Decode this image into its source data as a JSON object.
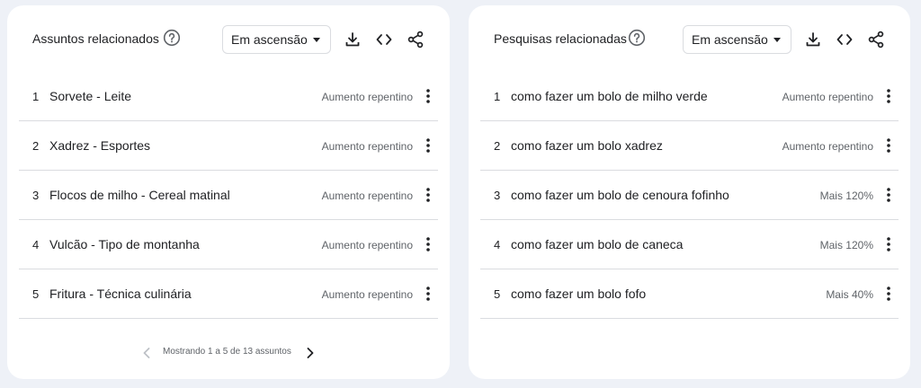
{
  "related_topics": {
    "title": "Assuntos relacionados",
    "filter": "Em ascensão",
    "rows": [
      {
        "rank": "1",
        "label": "Sorvete - Leite",
        "value": "Aumento repentino"
      },
      {
        "rank": "2",
        "label": "Xadrez - Esportes",
        "value": "Aumento repentino"
      },
      {
        "rank": "3",
        "label": "Flocos de milho - Cereal matinal",
        "value": "Aumento repentino"
      },
      {
        "rank": "4",
        "label": "Vulcão - Tipo de montanha",
        "value": "Aumento repentino"
      },
      {
        "rank": "5",
        "label": "Fritura - Técnica culinária",
        "value": "Aumento repentino"
      }
    ],
    "pagination": "Mostrando 1 a 5 de 13 assuntos"
  },
  "related_queries": {
    "title": "Pesquisas relacionadas",
    "filter": "Em ascensão",
    "rows": [
      {
        "rank": "1",
        "label": "como fazer um bolo de milho verde",
        "value": "Aumento repentino"
      },
      {
        "rank": "2",
        "label": "como fazer um bolo xadrez",
        "value": "Aumento repentino"
      },
      {
        "rank": "3",
        "label": "como fazer um bolo de cenoura fofinho",
        "value": "Mais 120%"
      },
      {
        "rank": "4",
        "label": "como fazer um bolo de caneca",
        "value": "Mais 120%"
      },
      {
        "rank": "5",
        "label": "como fazer um bolo fofo",
        "value": "Mais 40%"
      }
    ]
  },
  "icons": {
    "help": "help-circle-icon",
    "download": "download-icon",
    "embed": "code-icon",
    "share": "share-icon",
    "more": "more-vert-icon",
    "prev": "chevron-left-icon",
    "next": "chevron-right-icon"
  },
  "colors": {
    "background": "#eef1f7",
    "card": "#ffffff",
    "text": "#202124",
    "secondary_text": "#5f6368",
    "divider": "#dadce0",
    "disabled": "#bdc1c6"
  }
}
